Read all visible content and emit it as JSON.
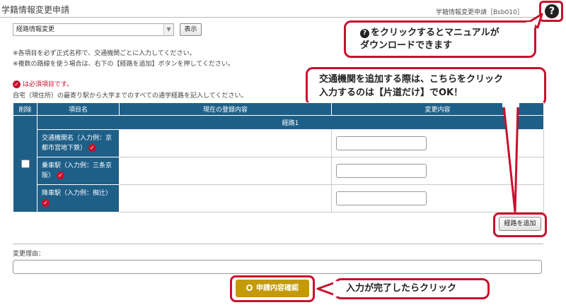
{
  "header": {
    "page_title": "学籍情報変更申請",
    "screen_id": "学籍情報変更申請［Bsb010］",
    "help_icon_glyph": "?"
  },
  "controls": {
    "select_value": "経路情報変更",
    "select_arrow": "▼",
    "show_button": "表示"
  },
  "notes": {
    "line1": "※各項目を必ず正式名称で、交通機関ごとに入力してください。",
    "line2": "※複数の路線を使う場合は、右下の【経路を追加】ボタンを押してください。",
    "required_legend": "は必須項目です。",
    "required_mark": "✓",
    "instruction": "自宅（現住所）の最寄り駅から大学までのすべての通学経路を記入してください。"
  },
  "table": {
    "headers": {
      "delete": "削除",
      "item": "項目名",
      "current": "現在の登録内容",
      "change": "変更内容"
    },
    "route_label": "経路1",
    "rows": [
      {
        "label": "交通機関名（入力例：京都市営地下鉄）",
        "current": "",
        "change": ""
      },
      {
        "label": "乗車駅（入力例：三条京阪）",
        "current": "",
        "change": ""
      },
      {
        "label": "降車駅（入力例：椥辻）",
        "current": "",
        "change": ""
      }
    ]
  },
  "buttons": {
    "add_route": "経路を追加",
    "confirm": "申請内容確認"
  },
  "reason": {
    "label": "変更理由：",
    "value": ""
  },
  "callouts": {
    "manual_line1": "をクリックするとマニュアルが",
    "manual_line2": "ダウンロードできます",
    "manual_icon": "?",
    "add_line1": "交通機関を追加する際は、こちらをクリック",
    "add_line2": "入力するのは【片道だけ】でOK！",
    "confirm": "入力が完了したらクリック"
  },
  "colors": {
    "table_header": "#1e5f88",
    "highlight": "#c8102e",
    "confirm_button": "#c49a0a"
  }
}
